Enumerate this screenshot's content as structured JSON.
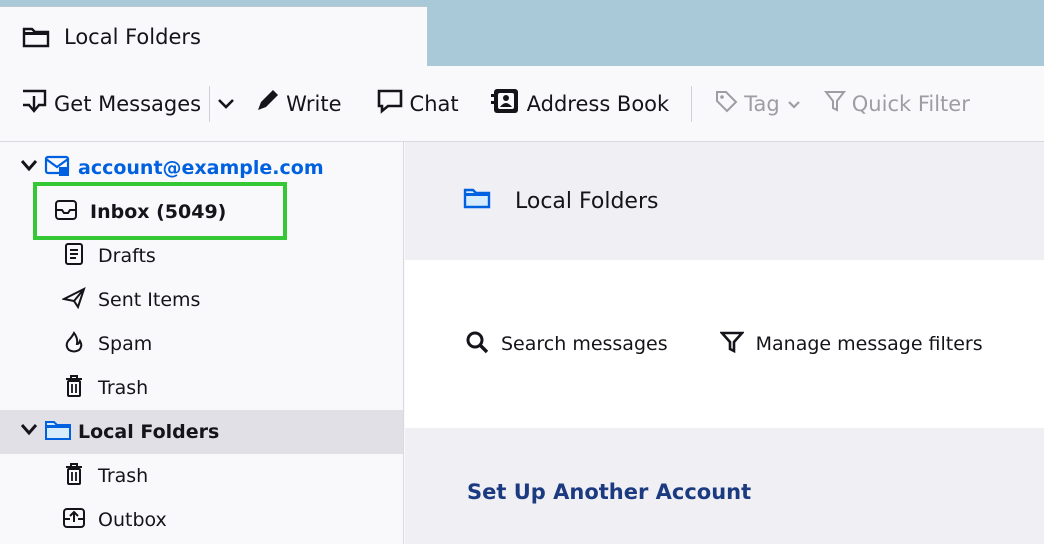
{
  "tab": {
    "title": "Local Folders"
  },
  "toolbar": {
    "get_messages": "Get Messages",
    "write": "Write",
    "chat": "Chat",
    "address_book": "Address Book",
    "tag": "Tag",
    "quick_filter": "Quick Filter"
  },
  "folders": {
    "account": "account@example.com",
    "inbox": "Inbox (5049)",
    "drafts": "Drafts",
    "sent": "Sent Items",
    "spam": "Spam",
    "trash": "Trash",
    "local_folders": "Local Folders",
    "local_trash": "Trash",
    "outbox": "Outbox"
  },
  "content": {
    "header_title": "Local Folders",
    "search_messages": "Search messages",
    "manage_filters": "Manage message filters",
    "setup_account": "Set Up Another Account"
  },
  "colors": {
    "accent": "#0061e0",
    "highlight_box": "#35c835",
    "tabbar": "#a9c8d8"
  }
}
